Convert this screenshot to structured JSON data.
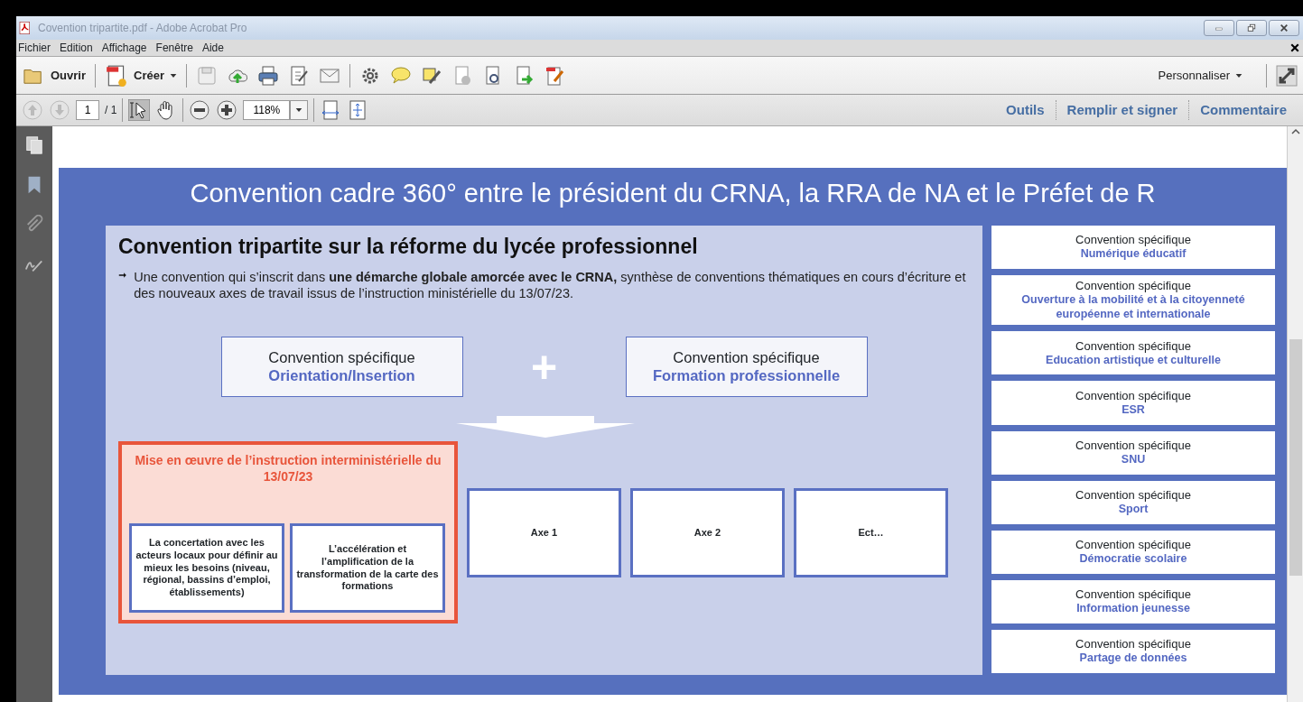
{
  "window": {
    "title": "Covention tripartite.pdf - Adobe Acrobat Pro"
  },
  "menu": [
    "Fichier",
    "Edition",
    "Affichage",
    "Fenêtre",
    "Aide"
  ],
  "toolbar": {
    "open": "Ouvrir",
    "create": "Créer",
    "customize": "Personnaliser"
  },
  "navigation": {
    "page": "1",
    "page_total": "/ 1",
    "zoom": "118%"
  },
  "panes": [
    "Outils",
    "Remplir et signer",
    "Commentaire"
  ],
  "slide": {
    "title": "Convention cadre 360° entre le président du CRNA, la RRA de NA et le Préfet de R",
    "heading": "Convention tripartite sur la réforme du lycée professionnel",
    "bullet": "Une convention qui s’inscrit dans **une démarche globale amorcée avec le CRNA,** synthèse de conventions thématiques en cours d’écriture et des nouveaux axes de travail issus de l’instruction ministérielle du 13/07/23.",
    "specific_conventions": [
      {
        "label": "Convention spécifique",
        "topic": "Orientation/Insertion"
      },
      {
        "label": "Convention spécifique",
        "topic": "Formation professionnelle"
      }
    ],
    "plus": "+",
    "implementation": {
      "title": "Mise en œuvre de l’instruction interministérielle du 13/07/23",
      "items": [
        "La concertation avec les acteurs locaux pour définir au mieux les besoins (niveau, régional, bassins d’emploi, établissements)",
        "L’accélération et l’amplification de la transformation de la carte des formations"
      ]
    },
    "axes": [
      "Axe 1",
      "Axe 2",
      "Ect…"
    ],
    "side_conventions": [
      {
        "label": "Convention spécifique",
        "topic": "Numérique éducatif"
      },
      {
        "label": "Convention spécifique",
        "topic": "Ouverture à la mobilité et à la citoyenneté européenne et internationale"
      },
      {
        "label": "Convention spécifique",
        "topic": "Education artistique et culturelle"
      },
      {
        "label": "Convention spécifique",
        "topic": "ESR"
      },
      {
        "label": "Convention spécifique",
        "topic": "SNU"
      },
      {
        "label": "Convention spécifique",
        "topic": "Sport"
      },
      {
        "label": "Convention spécifique",
        "topic": "Démocratie scolaire"
      },
      {
        "label": "Convention spécifique",
        "topic": "Information jeunesse"
      },
      {
        "label": "Convention spécifique",
        "topic": "Partage de données"
      }
    ]
  }
}
